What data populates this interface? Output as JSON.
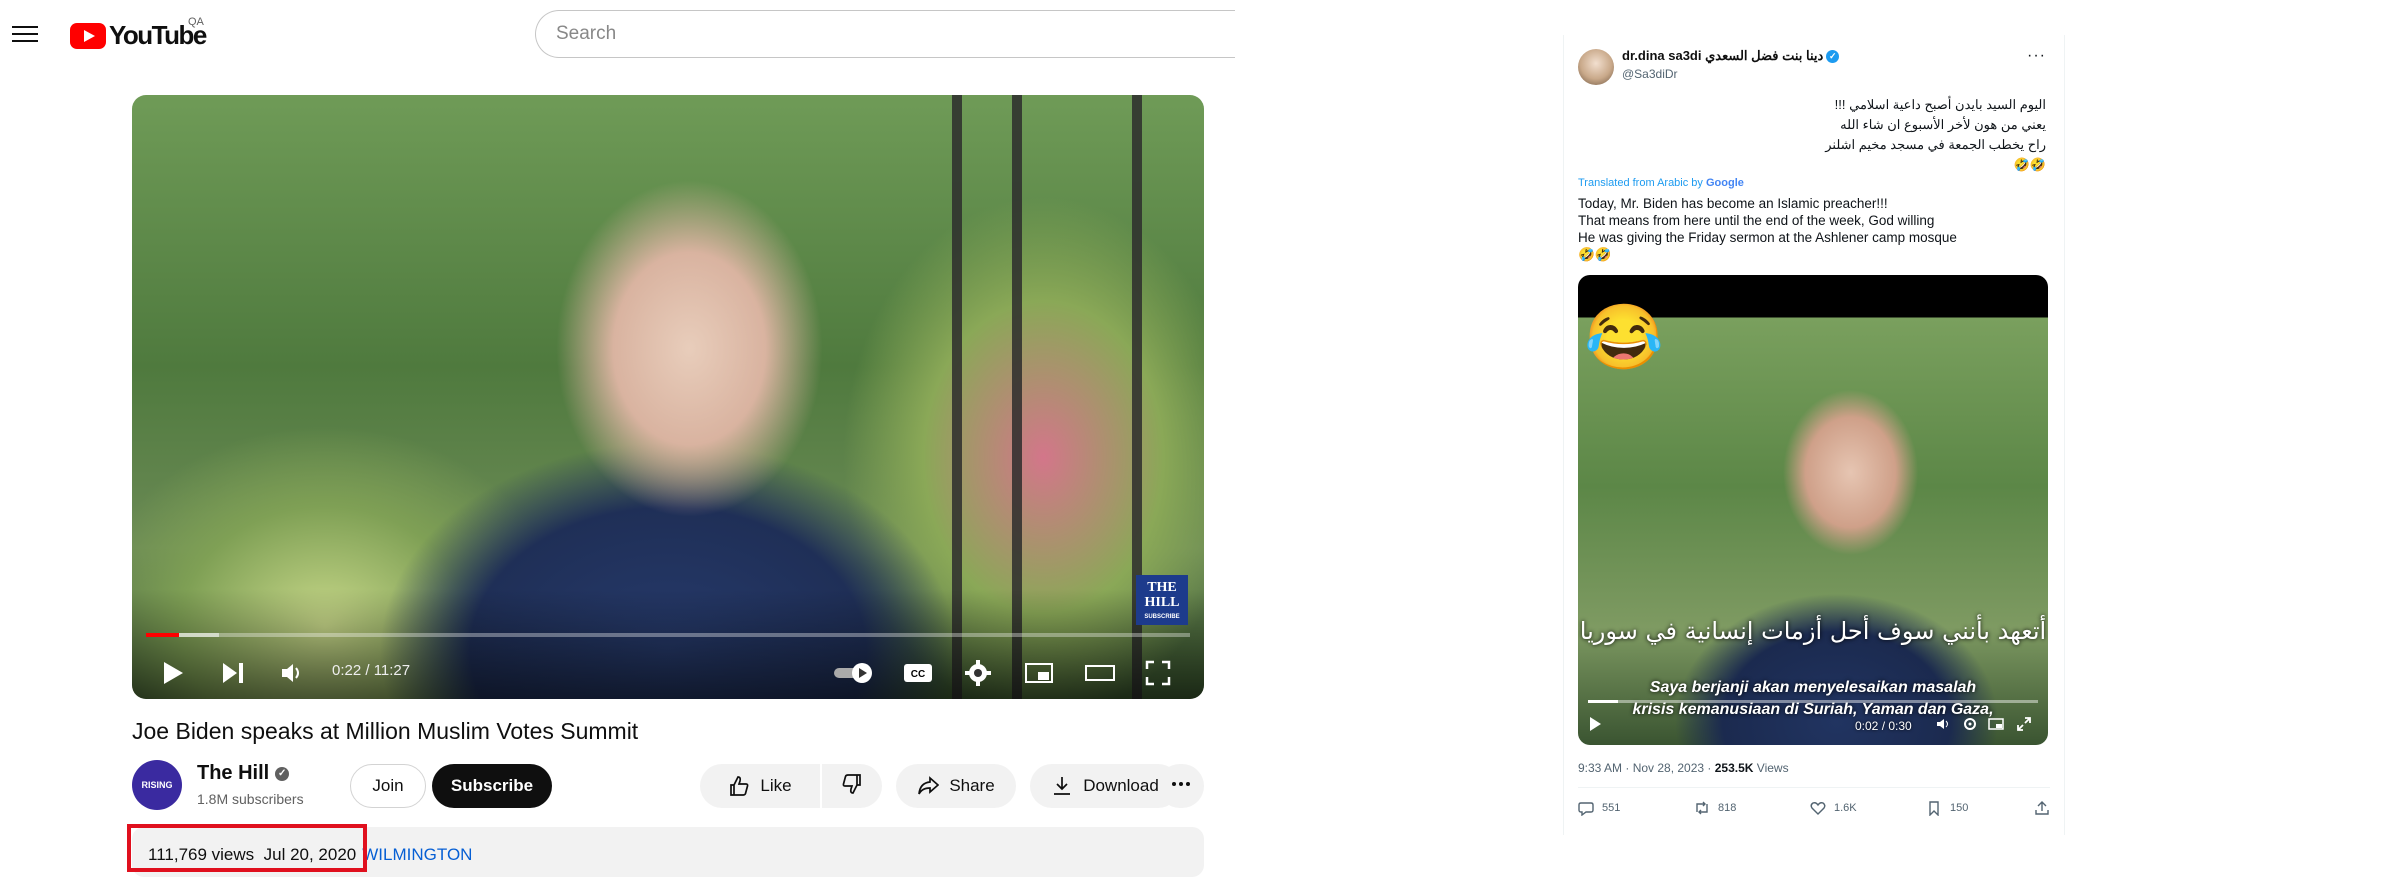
{
  "youtube": {
    "logo_text": "YouTube",
    "country_code": "QA",
    "search_placeholder": "Search",
    "player": {
      "time": "0:22 / 11:27",
      "progress": 0.032,
      "watermark_line1": "THE",
      "watermark_line2": "HILL",
      "watermark_sub": "SUBSCRIBE"
    },
    "video_title": "Joe Biden speaks at Million Muslim Votes Summit",
    "channel": {
      "avatar_text": "RISING",
      "name": "The Hill",
      "subscribers": "1.8M subscribers"
    },
    "buttons": {
      "join": "Join",
      "subscribe": "Subscribe",
      "like": "Like",
      "share": "Share",
      "download": "Download"
    },
    "info": {
      "views": "111,769 views",
      "date": "Jul 20, 2020",
      "location": "WILMINGTON"
    },
    "colors": {
      "brand": "#ff0000",
      "highlight_box": "#e0101e",
      "link": "#065fd4"
    }
  },
  "tweet": {
    "author_name": "dr.dina sa3di دينا بنت فضل السعدي",
    "handle": "@Sa3diDr",
    "arabic_lines": [
      "اليوم السيد بايدن أصبح داعية اسلامي !!!",
      "يعني من هون لأخر الأسبوع ان شاء الله",
      "راح يخطب الجمعة في مسجد مخيم اشلنر",
      "🤣🤣"
    ],
    "translated_label": "Translated from Arabic by",
    "translator": "Google",
    "english_lines": [
      "Today, Mr. Biden has become an Islamic preacher!!!",
      "That means from here until the end of the week, God willing",
      "He was giving the Friday sermon at the Ashlener camp mosque",
      "🤣🤣"
    ],
    "video": {
      "emoji": "😂",
      "subtitle_arabic": "أتعهد بأنني سوف أحل أزمات إنسانية في سوريا",
      "subtitle_line1": "Saya berjanji akan menyelesaikan masalah",
      "subtitle_line2": "krisis kemanusiaan di Suriah, Yaman dan Gaza,",
      "time": "0:02 / 0:30",
      "progress": 0.067
    },
    "timestamp": "9:33 AM · Nov 28, 2023 · ",
    "views_count": "253.5K",
    "views_label": " Views",
    "actions": {
      "replies": "551",
      "reposts": "818",
      "likes": "1.6K",
      "bookmarks": "150"
    },
    "colors": {
      "verified": "#1d9bf0",
      "muted": "#536471"
    }
  }
}
